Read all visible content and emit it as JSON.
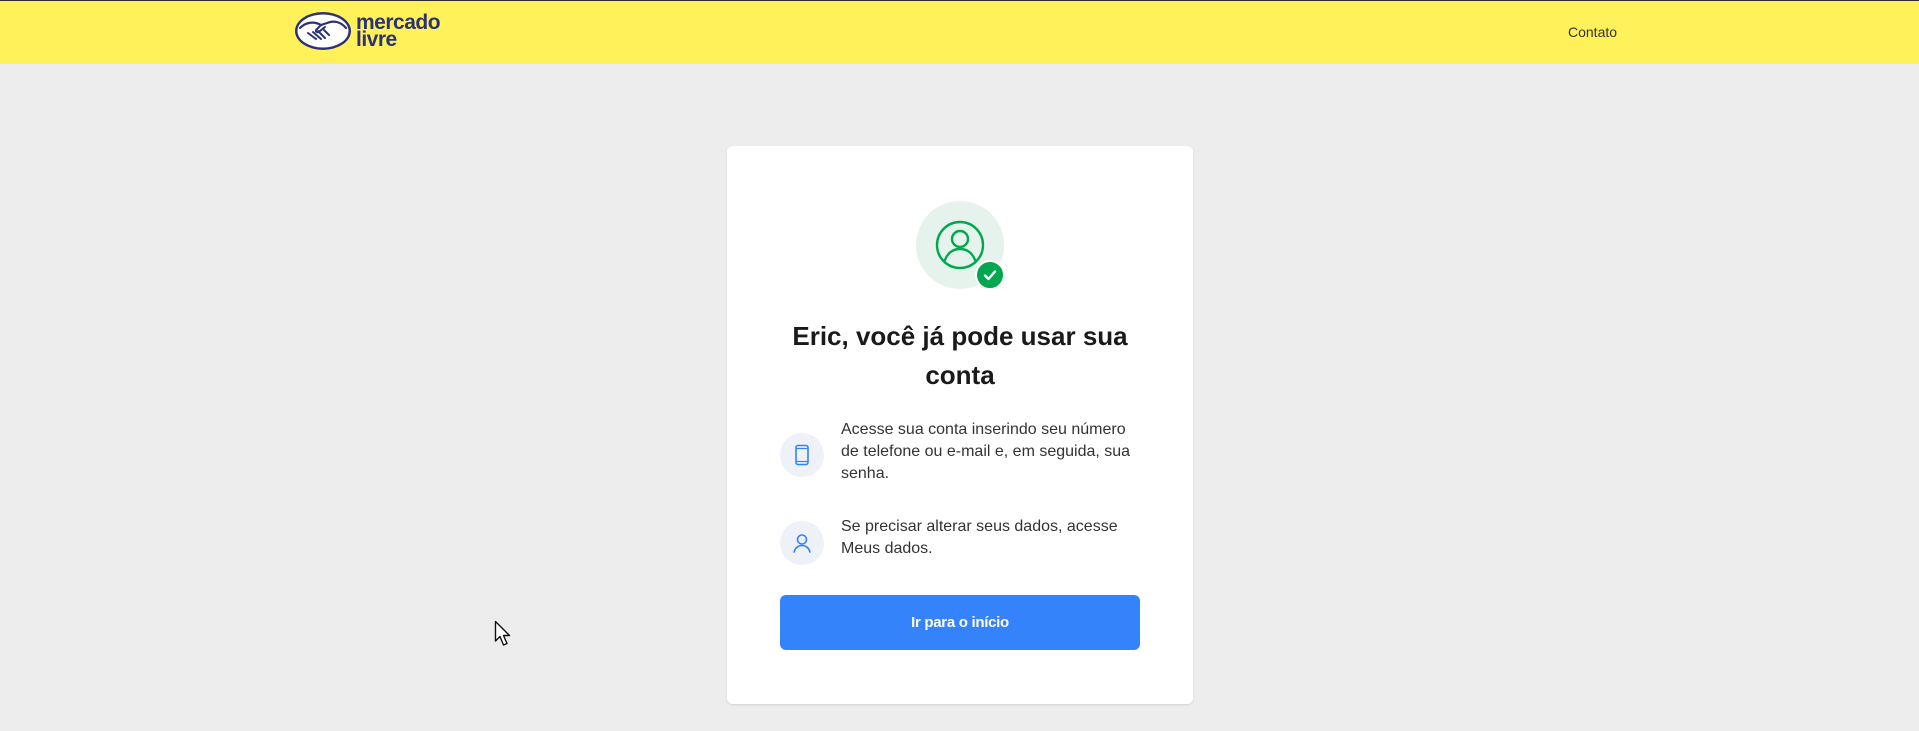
{
  "header": {
    "logo_line1": "mercado",
    "logo_line2": "livre",
    "contact_label": "Contato"
  },
  "card": {
    "title": "Eric, você já pode usar sua conta",
    "info_items": [
      {
        "icon": "smartphone-icon",
        "text": "Acesse sua conta inserindo seu número de telefone ou e-mail e, em seguida, sua senha."
      },
      {
        "icon": "person-icon",
        "text": "Se precisar alterar seus dados, acesse Meus dados."
      }
    ],
    "button_label": "Ir para o início"
  },
  "colors": {
    "header_bg": "#fff159",
    "page_bg": "#ededed",
    "accent_blue": "#3483fa",
    "success_green": "#00a650"
  }
}
